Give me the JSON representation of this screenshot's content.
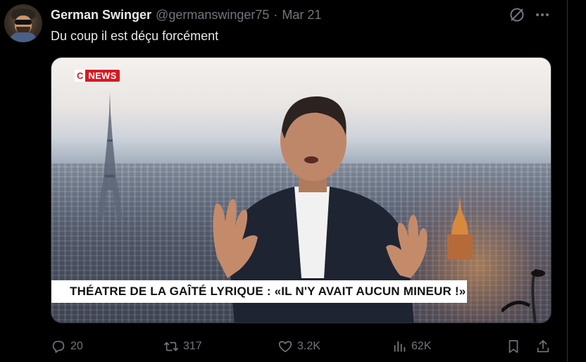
{
  "tweet": {
    "author_name": "German Swinger",
    "handle": "@germanswinger75",
    "separator": "·",
    "date": "Mar 21",
    "text": "Du coup il est déçu forcément"
  },
  "media": {
    "channel_logo_c": "C",
    "channel_logo_text": "NEWS",
    "banner_text": "THÉATRE DE LA GAÎTÉ LYRIQUE : «IL N'Y AVAIT AUCUN MINEUR !»"
  },
  "actions": {
    "replies": "20",
    "reposts": "317",
    "likes": "3.2K",
    "views": "62K"
  },
  "icons": [
    "grok-icon",
    "more-icon",
    "reply-icon",
    "repost-icon",
    "like-icon",
    "views-icon",
    "bookmark-icon",
    "share-icon"
  ],
  "colors": {
    "background": "#000000",
    "text_primary": "#e7e9ea",
    "text_secondary": "#71767b",
    "cnews_red": "#d71921"
  }
}
